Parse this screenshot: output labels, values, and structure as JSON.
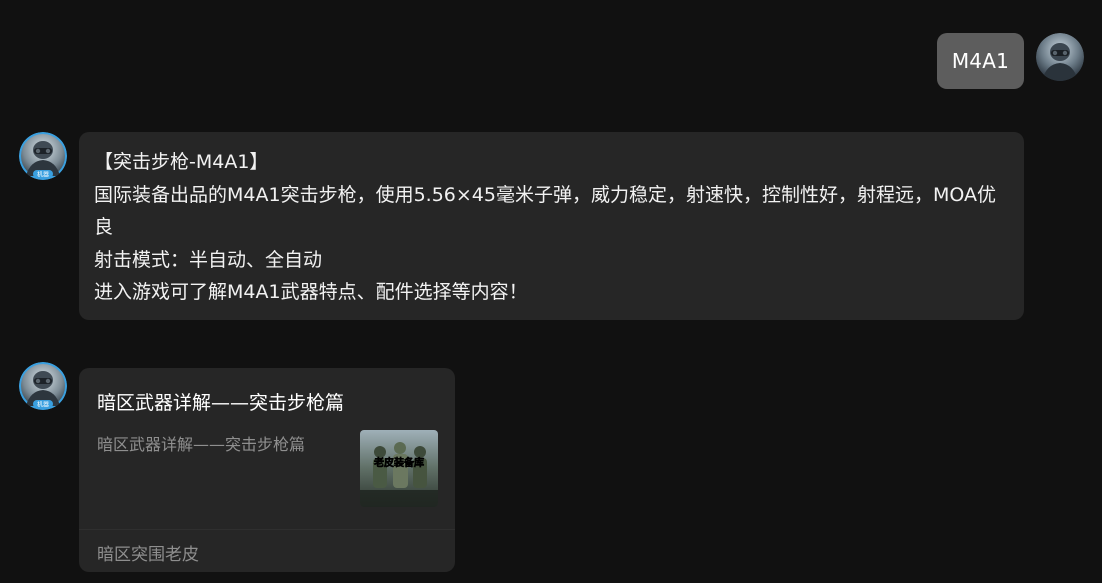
{
  "user_message": {
    "text": "M4A1"
  },
  "bot_message": {
    "lines": [
      "【突击步枪-M4A1】",
      "国际装备出品的M4A1突击步枪，使用5.56×45毫米子弹，威力稳定，射速快，控制性好，射程远，MOA优良",
      "射击模式：半自动、全自动",
      "进入游戏可了解M4A1武器特点、配件选择等内容！"
    ]
  },
  "article_card": {
    "title": "暗区武器详解——突击步枪篇",
    "description": "暗区武器详解——突击步枪篇",
    "thumbnail_caption": "老皮装备库",
    "source": "暗区突围老皮"
  },
  "avatars": {
    "bot_badge": "机器"
  },
  "colors": {
    "background": "#111111",
    "user_bubble": "#5d5d5d",
    "bot_bubble": "#262626",
    "muted_text": "#8f8f8f",
    "avatar_ring": "#3aa0e0"
  }
}
